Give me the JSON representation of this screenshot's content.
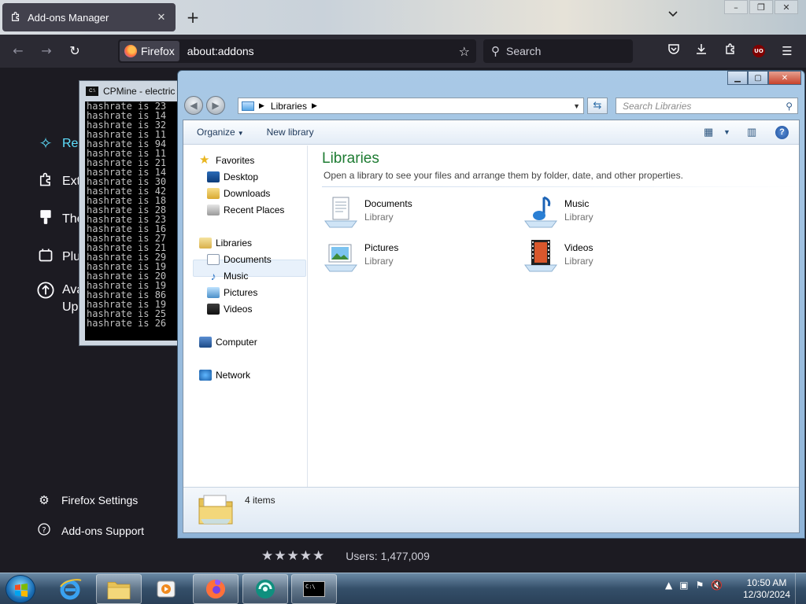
{
  "firefox": {
    "tab_title": "Add-ons Manager",
    "identity_label": "Firefox",
    "url": "about:addons",
    "search_placeholder": "Search",
    "ublock_label": "UO"
  },
  "addons": {
    "categories": [
      {
        "label": "Rec",
        "icon": "sparkle-icon"
      },
      {
        "label": "Ext",
        "icon": "puzzle-icon"
      },
      {
        "label": "The",
        "icon": "brush-icon"
      },
      {
        "label": "Plu",
        "icon": "plugin-icon"
      },
      {
        "label_line1": "Ava",
        "label_line2": "Up",
        "icon": "upload-arrow-icon"
      }
    ],
    "footer": {
      "settings_label": "Firefox Settings",
      "support_label": "Add-ons Support"
    },
    "rating_stars": 5,
    "users_label": "Users: 1,477,009"
  },
  "cmd": {
    "title": "CPMine - electric",
    "icon_label": "C:\\",
    "lines": [
      "hashrate is 23",
      "hashrate is 14",
      "hashrate is 32",
      "hashrate is 11",
      "hashrate is 94",
      "hashrate is 11",
      "hashrate is 21",
      "hashrate is 14",
      "hashrate is 30",
      "hashrate is 42",
      "hashrate is 18",
      "hashrate is 28",
      "hashrate is 23",
      "hashrate is 16",
      "hashrate is 27",
      "hashrate is 21",
      "hashrate is 29",
      "hashrate is 19",
      "hashrate is 20",
      "hashrate is 19",
      "hashrate is 86",
      "hashrate is 19",
      "hashrate is 25",
      "hashrate is 26"
    ]
  },
  "explorer": {
    "breadcrumb": "Libraries",
    "search_placeholder": "Search Libraries",
    "organize_label": "Organize",
    "new_library_label": "New library",
    "nav": {
      "favorites": "Favorites",
      "desktop": "Desktop",
      "downloads": "Downloads",
      "recent_places": "Recent Places",
      "libraries": "Libraries",
      "documents": "Documents",
      "music": "Music",
      "pictures": "Pictures",
      "videos": "Videos",
      "computer": "Computer",
      "network": "Network"
    },
    "content": {
      "title": "Libraries",
      "description": "Open a library to see your files and arrange them by folder, date, and other properties.",
      "items": [
        {
          "name": "Documents",
          "type": "Library",
          "icon": "documents-library-icon"
        },
        {
          "name": "Music",
          "type": "Library",
          "icon": "music-library-icon"
        },
        {
          "name": "Pictures",
          "type": "Library",
          "icon": "pictures-library-icon"
        },
        {
          "name": "Videos",
          "type": "Library",
          "icon": "videos-library-icon"
        }
      ]
    },
    "details": {
      "item_count": "4 items"
    }
  },
  "taskbar": {
    "time": "10:50 AM",
    "date": "12/30/2024",
    "cmd_icon_label": "C:\\"
  }
}
